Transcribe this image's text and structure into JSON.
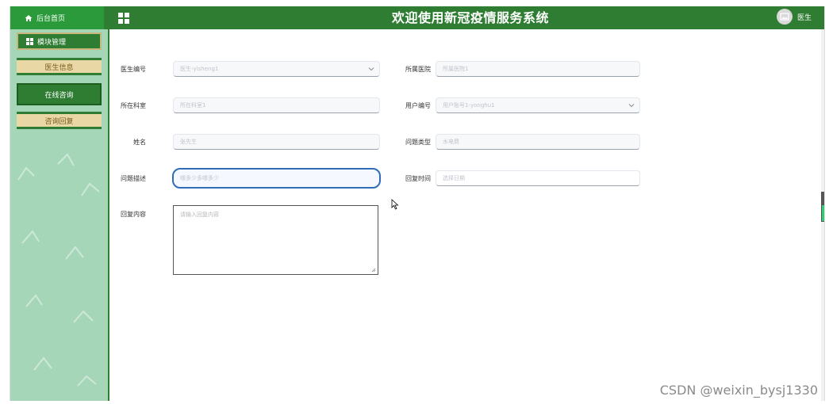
{
  "topbar": {
    "home_label": "后台首页",
    "title": "欢迎使用新冠疫情服务系统",
    "user_label": "医生"
  },
  "sidebar": {
    "items": [
      {
        "label": "模块管理",
        "icon": "grid-icon"
      },
      {
        "label": "医生信息"
      },
      {
        "label": "在线咨询"
      },
      {
        "label": "咨询回复"
      }
    ]
  },
  "form": {
    "doctor_no": {
      "label": "医生编号",
      "placeholder": "医生-yisheng1"
    },
    "hospital": {
      "label": "所属医院",
      "placeholder": "所属医院1"
    },
    "department": {
      "label": "所在科室",
      "placeholder": "所在科室1"
    },
    "user_no": {
      "label": "用户编号",
      "placeholder": "用户账号1-yonghu1"
    },
    "name": {
      "label": "姓名",
      "placeholder": "张先生"
    },
    "issue_type": {
      "label": "问题类型",
      "placeholder": "水电费"
    },
    "issue_desc": {
      "label": "问题描述",
      "placeholder": "哪多少多哪多少"
    },
    "reply_time": {
      "label": "回复时间",
      "placeholder": "选择日期"
    },
    "reply_content": {
      "label": "回复内容",
      "placeholder": "请输入回复内容"
    }
  },
  "watermark": "CSDN @weixin_bysj1330",
  "colors": {
    "header": "#2e7d32",
    "sidebar": "#a5d6b8",
    "focus": "#2f6db8"
  }
}
